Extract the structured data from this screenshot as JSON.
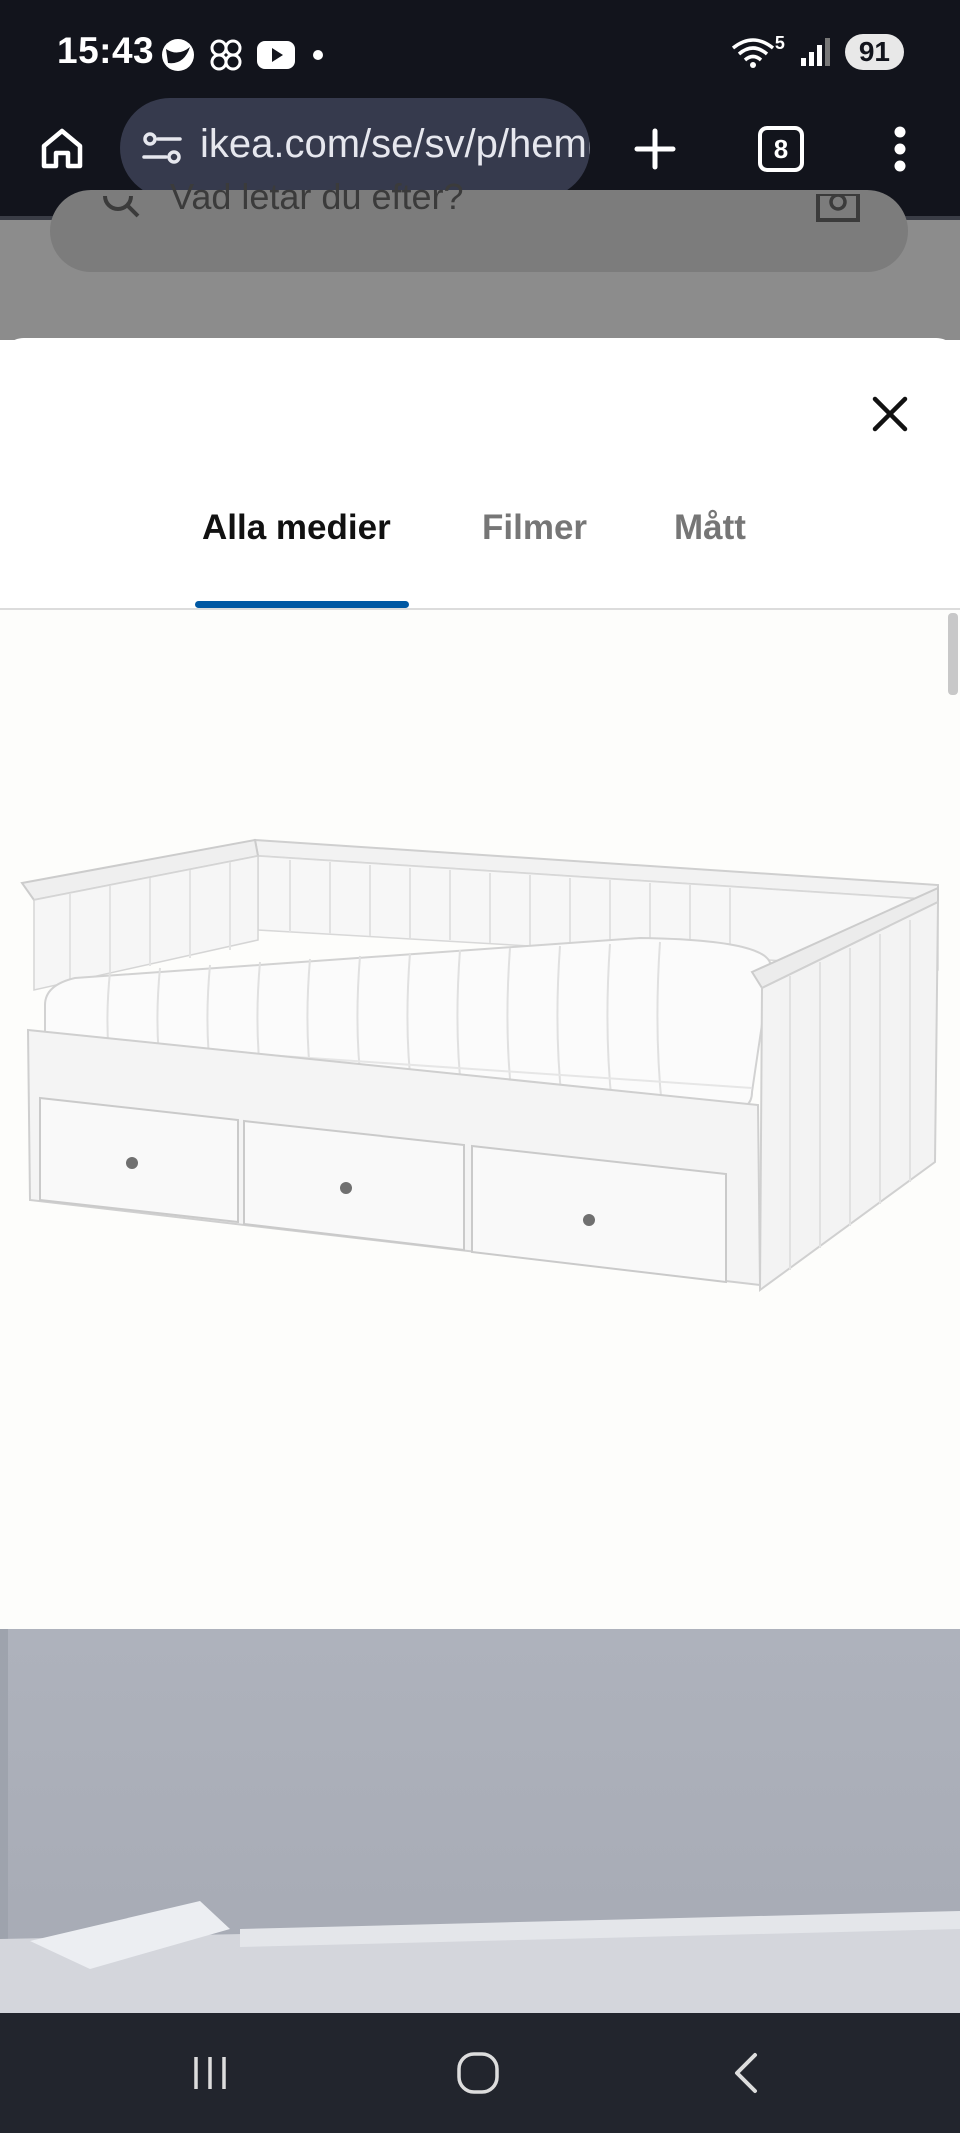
{
  "status_bar": {
    "time": "15:43",
    "battery": "91",
    "network": "5",
    "icons": [
      "sphere-app-icon",
      "pinwheel-app-icon",
      "youtube-icon",
      "dot-icon",
      "wifi-icon",
      "signal-icon"
    ]
  },
  "browser": {
    "url": "ikea.com/se/sv/p/hemnes",
    "tab_count": "8",
    "icons": [
      "home-icon",
      "site-settings-icon",
      "new-tab-icon",
      "tab-switcher-icon",
      "more-menu-icon"
    ]
  },
  "background_page": {
    "search_placeholder": "Vad letar du efter?"
  },
  "modal": {
    "tabs": [
      {
        "label": "Alla medier",
        "active": true
      },
      {
        "label": "Filmer",
        "active": false
      },
      {
        "label": "Mått",
        "active": false
      }
    ],
    "accent_color": "#0058a3",
    "media": [
      {
        "type": "product-image",
        "subject": "white daybed with three drawers and mattress"
      },
      {
        "type": "room-photo",
        "subject": "daybed in room with grey wall"
      }
    ]
  },
  "navigation_bar": {
    "icons": [
      "recent-apps-icon",
      "home-circle-icon",
      "back-icon"
    ]
  }
}
